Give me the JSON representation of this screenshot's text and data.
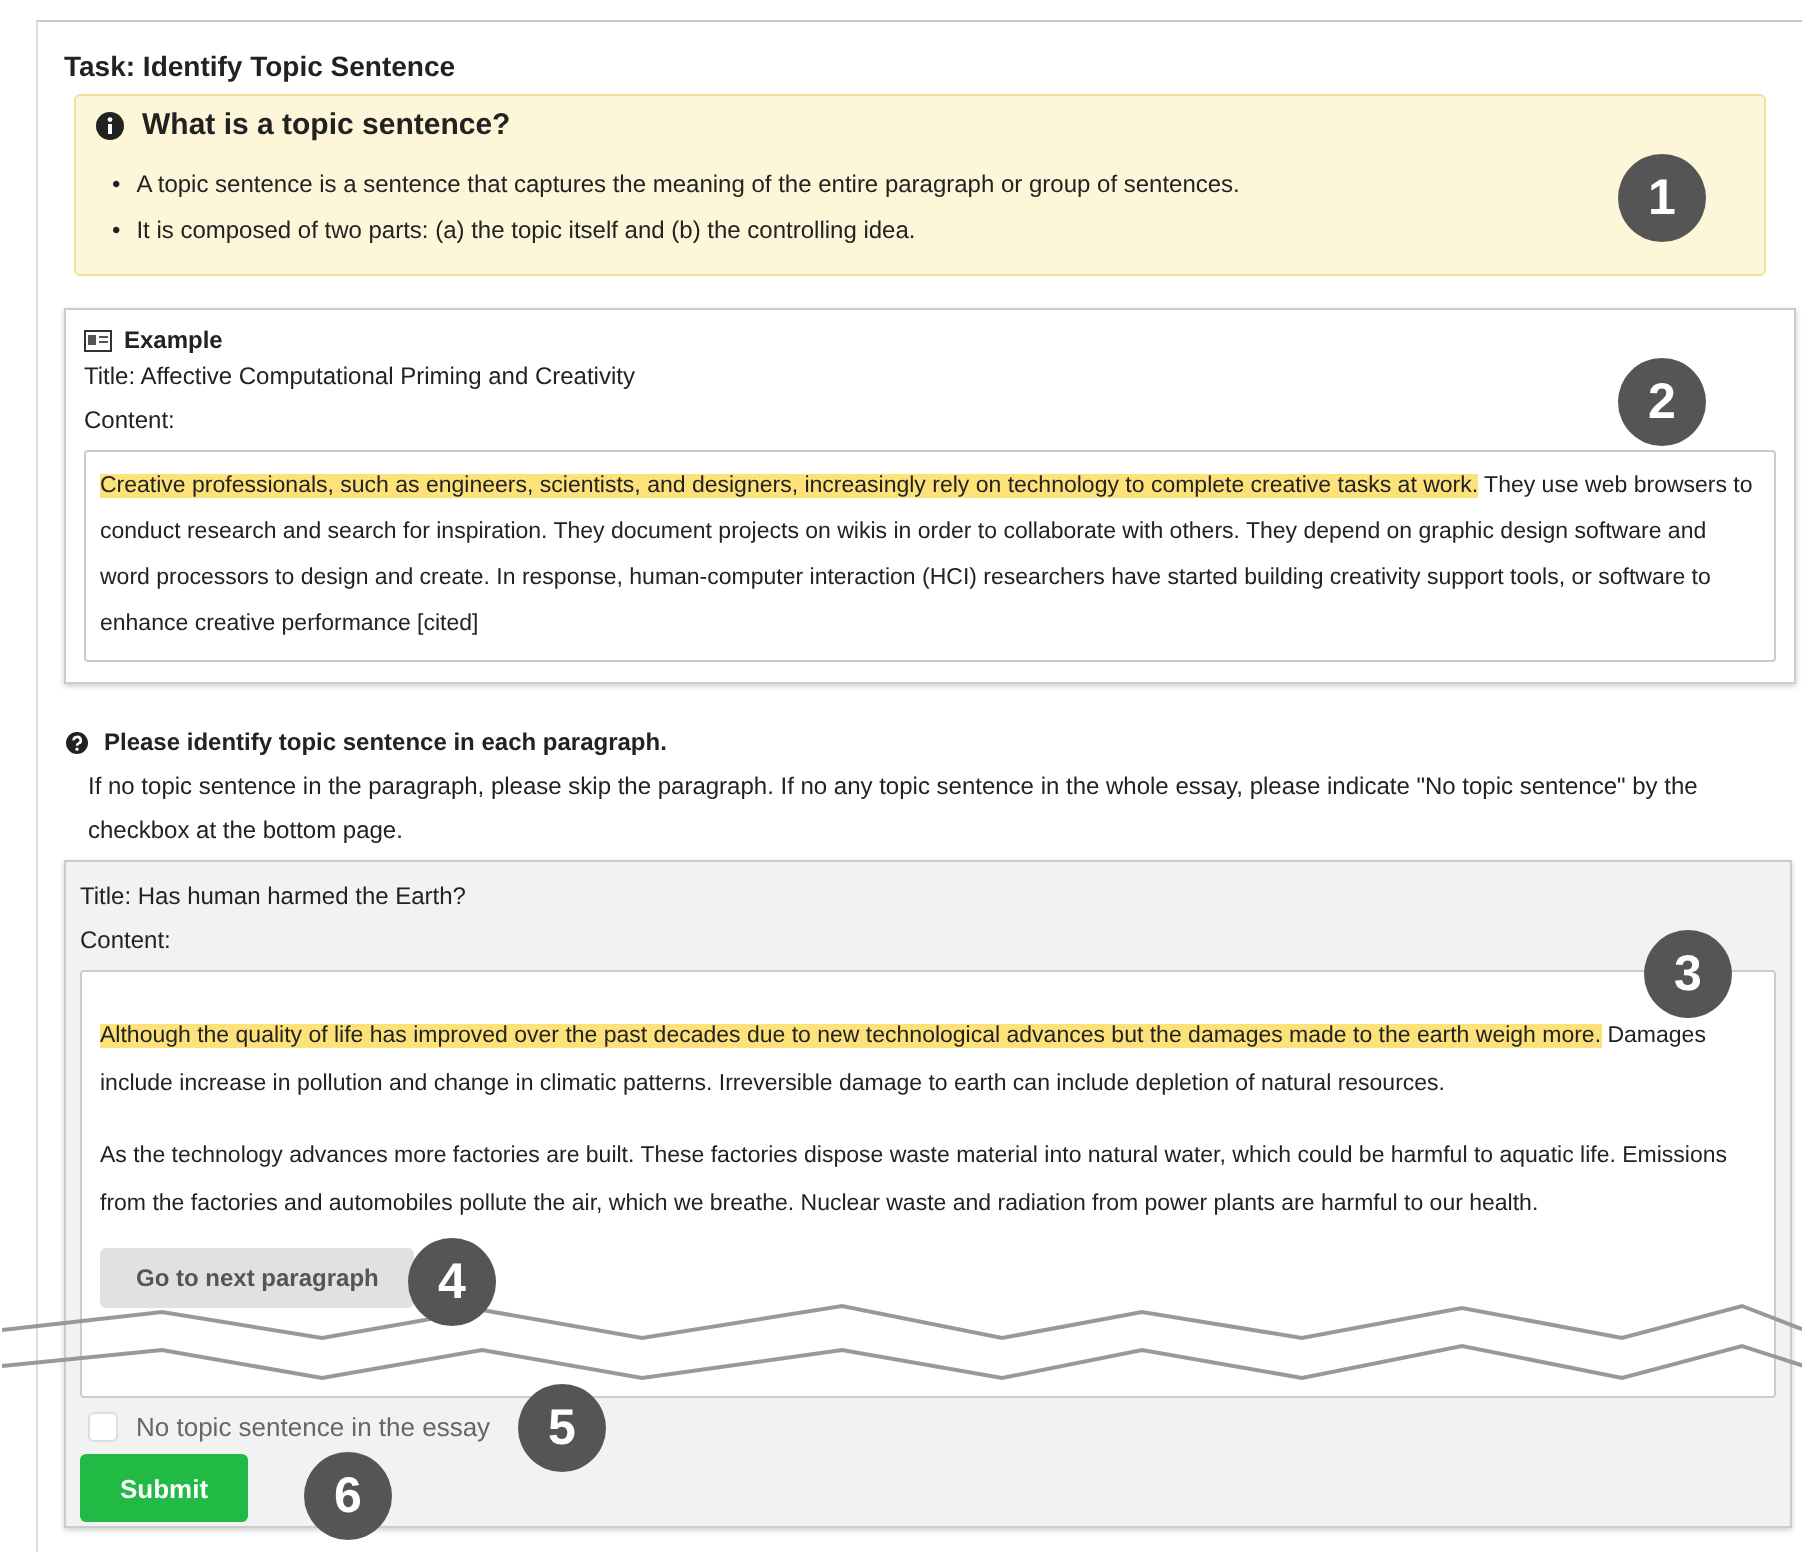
{
  "task_title": "Task: Identify Topic Sentence",
  "info": {
    "heading": "What is a topic sentence?",
    "bullets": [
      {
        "marker": "•",
        "text": "A topic sentence is a sentence that captures the meaning of the entire paragraph or group of sentences."
      },
      {
        "marker": "•",
        "text": "It is composed of two parts: (a) the topic itself and (b) the controlling idea."
      }
    ]
  },
  "example": {
    "heading": "Example",
    "title": "Title: Affective Computational Priming and Creativity",
    "content_label": "Content:",
    "paragraphs": [
      [
        {
          "text": "Creative professionals, such as engineers, scientists, and designers, increasingly rely on technology to complete creative tasks at work.",
          "highlighted": true
        },
        {
          "text": " They use web browsers to conduct research and search for inspiration. They document projects on wikis in order to collaborate with others. They depend on graphic design software and word processors to design and create. In response, human-computer interaction (HCI) researchers have started building creativity support tools, or software to enhance creative performance [cited]",
          "highlighted": false
        }
      ]
    ]
  },
  "question": {
    "heading": "Please identify topic sentence in each paragraph.",
    "instructions": "If no topic sentence in the paragraph, please skip the paragraph. If no any topic sentence in the whole essay, please indicate \"No topic sentence\" by the checkbox at the bottom page."
  },
  "essay": {
    "title": "Title: Has human harmed the Earth?",
    "content_label": "Content:",
    "paragraphs": [
      [
        {
          "text": "Although the quality of life has improved over the past decades due to new technological advances but the damages made to the earth weigh more.",
          "highlighted": true
        },
        {
          "text": " Damages include increase in pollution and change in climatic patterns. Irreversible damage to earth can include depletion of natural resources.",
          "highlighted": false
        }
      ],
      [
        {
          "text": "As the technology advances more factories are built. These factories dispose waste material into natural water, which could be harmful to aquatic life. Emissions from the factories and automobiles pollute the air, which we breathe. Nuclear waste and radiation from power plants are harmful to our health.",
          "highlighted": false
        }
      ]
    ],
    "next_button": "Go to next paragraph"
  },
  "no_topic": {
    "label": "No topic sentence in the essay",
    "checked": false
  },
  "submit_button": "Submit",
  "callouts": [
    "1",
    "2",
    "3",
    "4",
    "5",
    "6"
  ]
}
